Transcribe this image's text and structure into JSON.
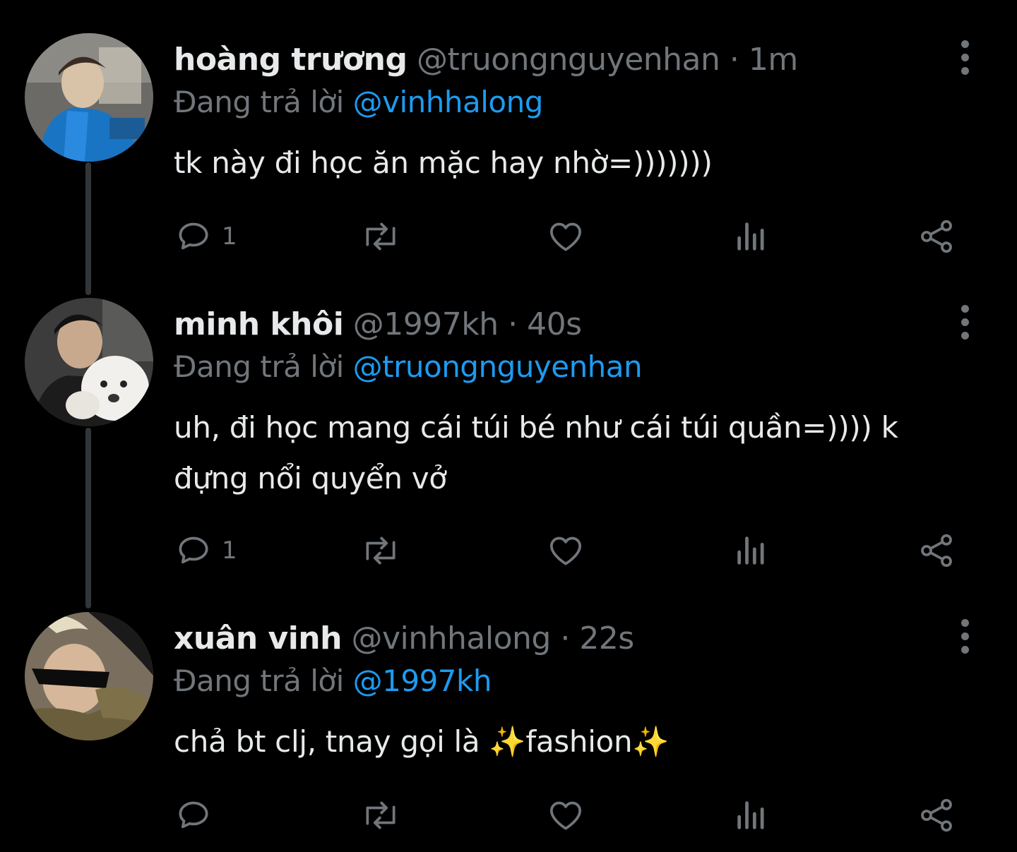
{
  "colors": {
    "background": "#000000",
    "primary_text": "#e7e9ea",
    "secondary_text": "#71767b",
    "link": "#1d9bf0",
    "thread_line": "#333639"
  },
  "tweets": [
    {
      "display_name": "hoàng trương",
      "handle": "@truongnguyenhan",
      "separator": "·",
      "time": "1m",
      "reply_prefix": "Đang trả lời",
      "reply_to": "@vinhhalong",
      "text": "tk này đi học ăn mặc hay nhờ=)))))))",
      "reply_count": "1",
      "icons": {
        "avatar": "profile-photo",
        "reply": "speech-bubble-icon",
        "retweet": "retweet-icon",
        "like": "heart-icon",
        "views": "bar-chart-icon",
        "share": "share-icon",
        "more": "vertical-dots-icon"
      }
    },
    {
      "display_name": "minh khôi",
      "handle": "@1997kh",
      "separator": "·",
      "time": "40s",
      "reply_prefix": "Đang trả lời",
      "reply_to": "@truongnguyenhan",
      "text": "uh, đi học mang cái túi bé như cái túi quần=)))) k đựng nổi quyển vở",
      "reply_count": "1",
      "icons": {
        "avatar": "profile-photo-with-dog",
        "reply": "speech-bubble-icon",
        "retweet": "retweet-icon",
        "like": "heart-icon",
        "views": "bar-chart-icon",
        "share": "share-icon",
        "more": "vertical-dots-icon"
      }
    },
    {
      "display_name": "xuân vinh",
      "handle": "@vinhhalong",
      "separator": "·",
      "time": "22s",
      "reply_prefix": "Đang trả lời",
      "reply_to": "@1997kh",
      "text": "chả bt clj, tnay gọi là ✨fashion✨",
      "reply_count": "",
      "icons": {
        "avatar": "profile-photo-sunglasses",
        "reply": "speech-bubble-icon",
        "retweet": "retweet-icon",
        "like": "heart-icon",
        "views": "bar-chart-icon",
        "share": "share-icon",
        "more": "vertical-dots-icon"
      }
    }
  ]
}
